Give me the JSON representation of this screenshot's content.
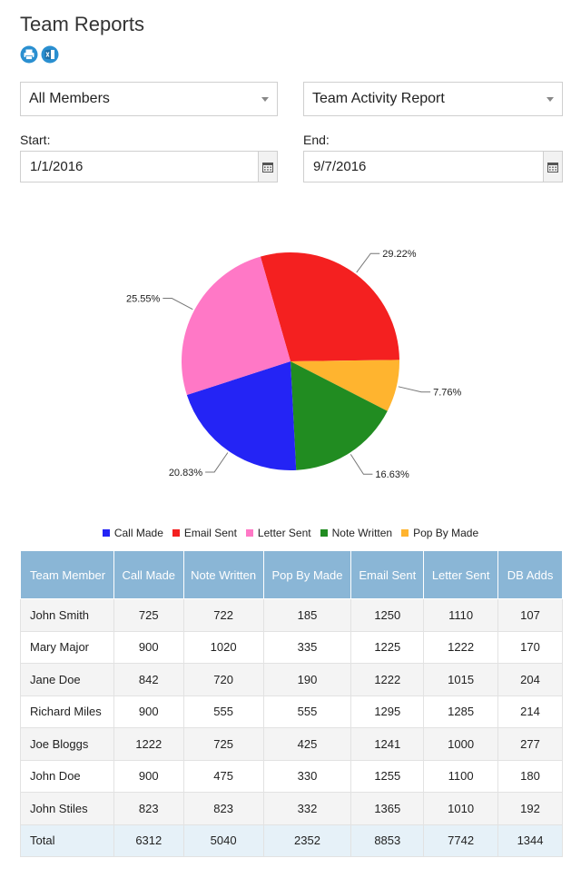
{
  "page": {
    "title": "Team Reports"
  },
  "toolbar": {
    "print_icon": "print-icon",
    "excel_icon": "excel-icon"
  },
  "filters": {
    "members": "All Members",
    "report": "Team Activity Report",
    "start_label": "Start:",
    "start_value": "1/1/2016",
    "end_label": "End:",
    "end_value": "9/7/2016"
  },
  "chart_data": {
    "type": "pie",
    "labels": [
      "Call Made",
      "Email Sent",
      "Letter Sent",
      "Note Written",
      "Pop By Made"
    ],
    "values": [
      20.83,
      29.22,
      25.55,
      16.63,
      7.76
    ],
    "value_labels": [
      "20.83%",
      "29.22%",
      "25.55%",
      "16.63%",
      "7.76%"
    ],
    "colors": [
      "#2424f5",
      "#f42020",
      "#ff78c6",
      "#218c21",
      "#ffb42f"
    ],
    "legend_position": "bottom"
  },
  "table": {
    "headers": [
      "Team Member",
      "Call Made",
      "Note Written",
      "Pop By Made",
      "Email Sent",
      "Letter Sent",
      "DB Adds"
    ],
    "rows": [
      [
        "John Smith",
        "725",
        "722",
        "185",
        "1250",
        "1110",
        "107"
      ],
      [
        "Mary Major",
        "900",
        "1020",
        "335",
        "1225",
        "1222",
        "170"
      ],
      [
        "Jane Doe",
        "842",
        "720",
        "190",
        "1222",
        "1015",
        "204"
      ],
      [
        "Richard Miles",
        "900",
        "555",
        "555",
        "1295",
        "1285",
        "214"
      ],
      [
        "Joe Bloggs",
        "1222",
        "725",
        "425",
        "1241",
        "1000",
        "277"
      ],
      [
        "John Doe",
        "900",
        "475",
        "330",
        "1255",
        "1100",
        "180"
      ],
      [
        "John Stiles",
        "823",
        "823",
        "332",
        "1365",
        "1010",
        "192"
      ]
    ],
    "total": [
      "Total",
      "6312",
      "5040",
      "2352",
      "8853",
      "7742",
      "1344"
    ]
  }
}
